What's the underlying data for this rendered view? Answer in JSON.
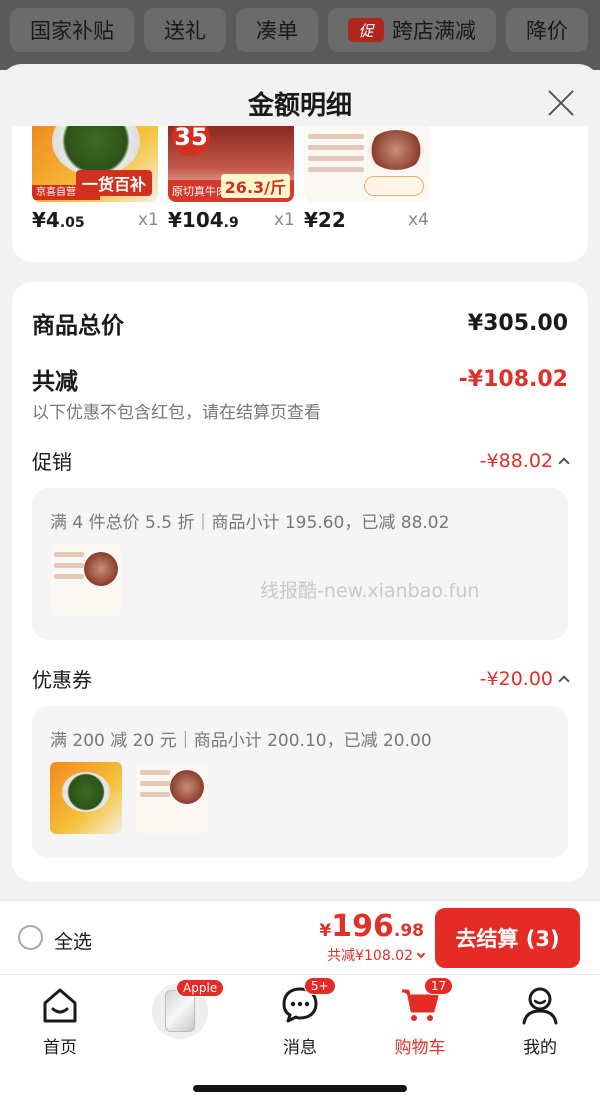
{
  "category_bar": {
    "items": [
      "国家补贴",
      "送礼",
      "凑单",
      "跨店满减",
      "降价"
    ],
    "promo_badge": "促"
  },
  "sheet": {
    "title": "金额明细"
  },
  "products": [
    {
      "price_int": "¥4",
      "price_dec": ".05",
      "qty": "x1",
      "image_label": "一货百补",
      "image_tag": "京喜自营包邮"
    },
    {
      "price_int": "¥104",
      "price_dec": ".9",
      "qty": "x1",
      "image_badge": "35",
      "image_strip": "原切真牛肉 不注水",
      "image_price": "26.3/斤"
    },
    {
      "price_int": "¥22",
      "price_dec": "",
      "qty": "x4"
    }
  ],
  "summary": {
    "goods_total_label": "商品总价",
    "goods_total_value": "¥305.00",
    "reduce_label": "共减",
    "reduce_value": "-¥108.02",
    "reduce_note": "以下优惠不包含红包，请在结算页查看",
    "promo_label": "促销",
    "promo_value": "-¥88.02",
    "promo_detail": "满 4 件总价 5.5 折｜商品小计 195.60，已减 88.02",
    "coupon_label": "优惠券",
    "coupon_value": "-¥20.00",
    "coupon_detail": "满 200 减 20 元｜商品小计 200.10，已减 20.00",
    "watermark": "线报酷-new.xianbao.fun"
  },
  "checkout": {
    "select_all": "全选",
    "currency": "¥",
    "total_int": "196",
    "total_dec": ".98",
    "total_reduce": "共减¥108.02",
    "pay_button": "去结算 (3)"
  },
  "tabbar": {
    "tabs": [
      {
        "label": "首页",
        "badge": ""
      },
      {
        "label": "",
        "badge": "Apple"
      },
      {
        "label": "消息",
        "badge": "5+"
      },
      {
        "label": "购物车",
        "badge": "17"
      },
      {
        "label": "我的",
        "badge": ""
      }
    ]
  },
  "colors": {
    "accent_red": "#e42b25",
    "text_red": "#e0302a"
  }
}
